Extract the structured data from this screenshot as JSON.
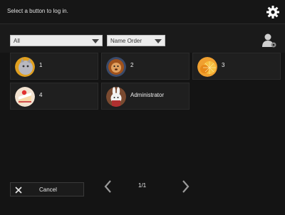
{
  "header": {
    "prompt": "Select a button to log in.",
    "settings_icon": "gear-icon"
  },
  "toolbar": {
    "filter_value": "All",
    "sort_value": "Name Order",
    "user_management_icon": "user-settings-icon"
  },
  "users": [
    {
      "name": "1",
      "avatar_icon": "cat-avatar-icon"
    },
    {
      "name": "2",
      "avatar_icon": "lion-avatar-icon"
    },
    {
      "name": "3",
      "avatar_icon": "orange-fruit-avatar-icon"
    },
    {
      "name": "4",
      "avatar_icon": "cake-avatar-icon"
    },
    {
      "name": "Administrator",
      "avatar_icon": "rabbit-avatar-icon"
    }
  ],
  "footer": {
    "cancel_label": "Cancel",
    "page_indicator": "1/1"
  },
  "colors": {
    "background": "#141414",
    "tile": "#1f1f1f"
  }
}
